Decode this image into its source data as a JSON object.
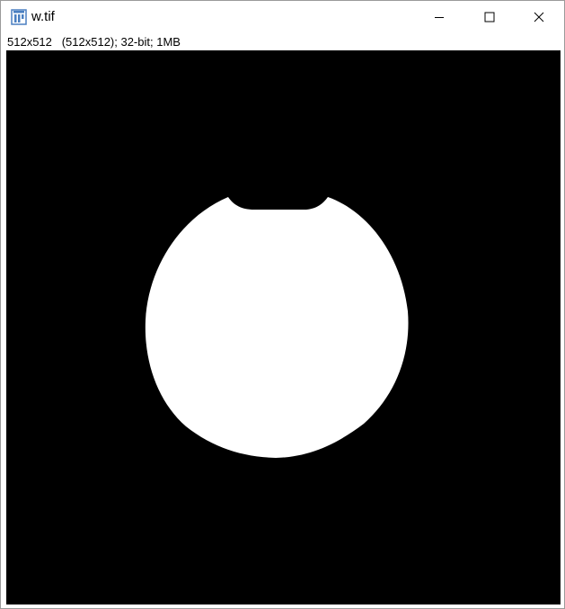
{
  "window": {
    "title": "w.tif",
    "icon": "imagej-icon",
    "controls": {
      "minimize_icon": "minimize-icon",
      "maximize_icon": "maximize-icon",
      "close_icon": "close-icon"
    }
  },
  "image_info": {
    "text": "512x512   (512x512); 32-bit; 1MB"
  },
  "image_view": {
    "background_color": "#000000",
    "foreground_color": "#ffffff",
    "content": "binary mask"
  }
}
